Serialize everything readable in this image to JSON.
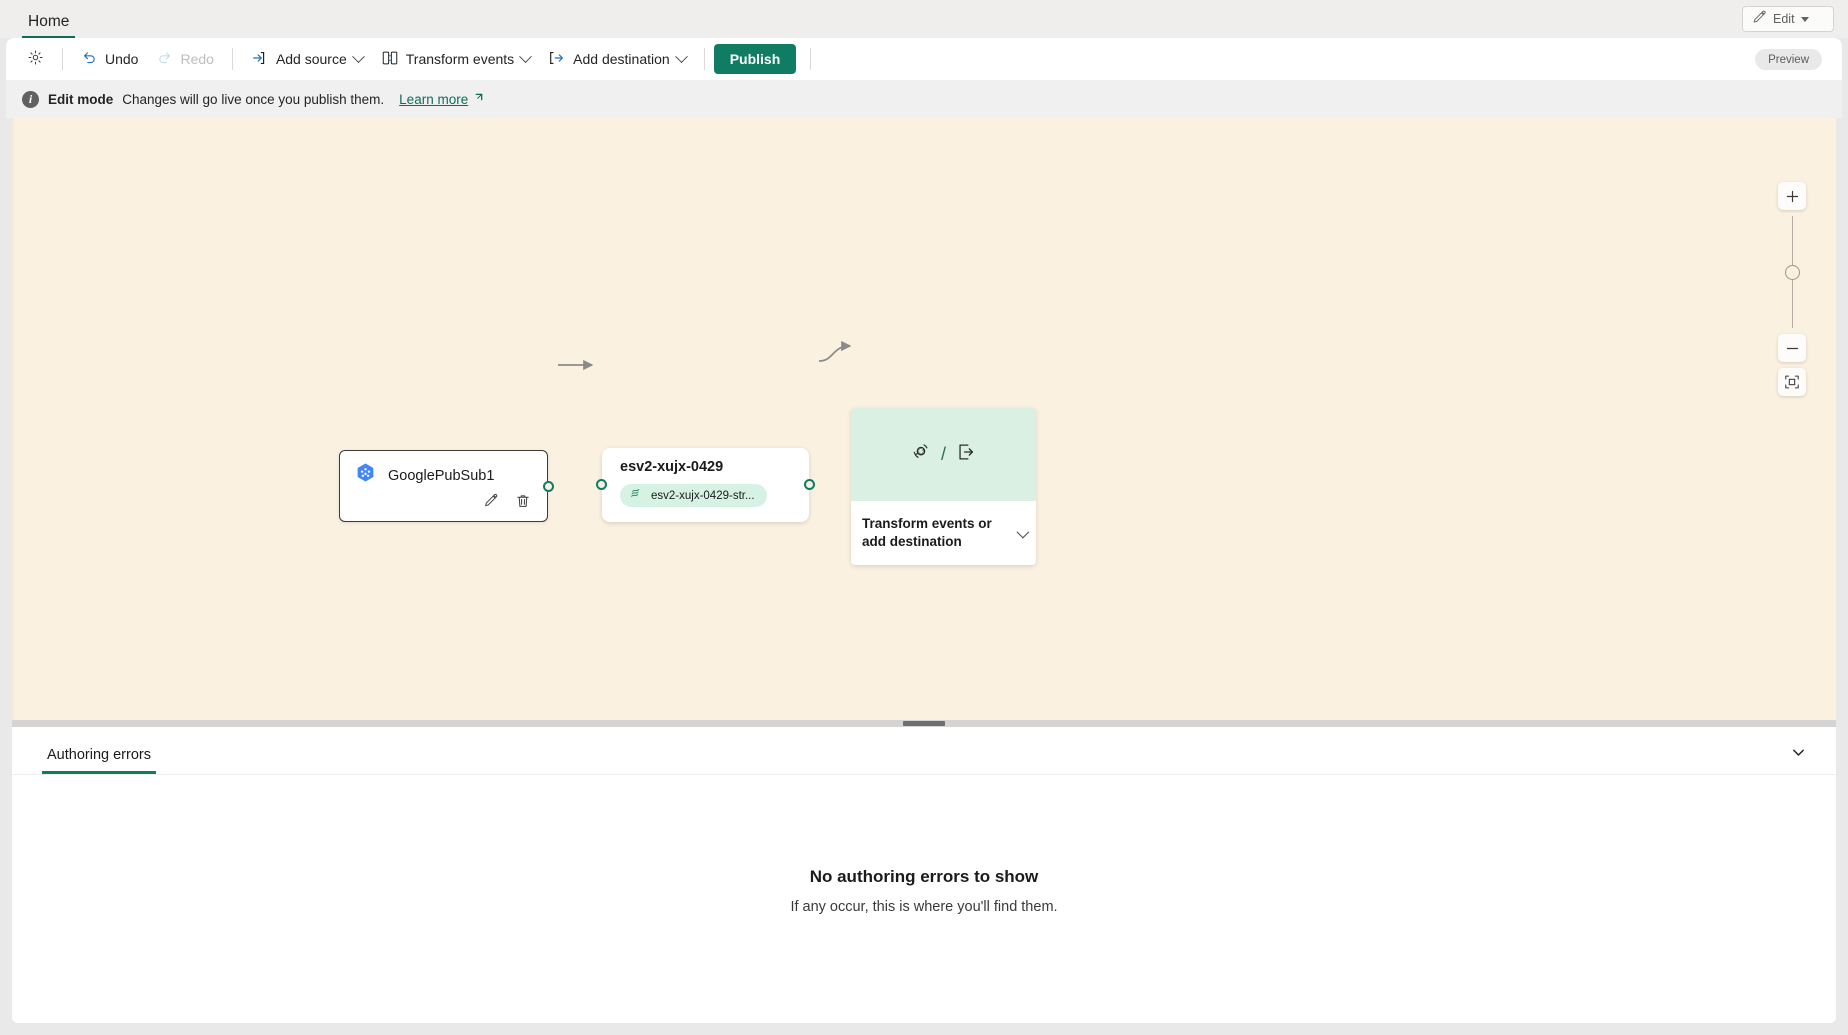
{
  "tabstrip": {
    "tab_label": "Home",
    "edit_button": {
      "label": "Edit",
      "icon": "pencil-icon"
    }
  },
  "commandbar": {
    "settings_icon": "gear-icon",
    "undo": "Undo",
    "redo": "Redo",
    "add_source": "Add source",
    "transform_events": "Transform events",
    "add_destination": "Add destination",
    "publish": "Publish",
    "publish_color": "#107c63",
    "preview_badge": "Preview"
  },
  "banner": {
    "icon": "info-icon",
    "title": "Edit mode",
    "message": "Changes will go live once you publish them.",
    "link": "Learn more",
    "link_icon": "external-link-icon"
  },
  "canvas": {
    "background": "#faf1e0",
    "nodes": {
      "source": {
        "name": "GooglePubSub1",
        "icon": "google-pubsub-icon",
        "icon_color": "#4285f4",
        "edit_icon": "pencil-icon",
        "delete_icon": "trash-icon"
      },
      "stream": {
        "name": "esv2-xujx-0429",
        "pill_label": "esv2-xujx-0429-str...",
        "pill_icon": "stream-icon",
        "pill_color": "#d6f2e4"
      },
      "placeholder": {
        "label": "Transform events or add destination",
        "icon_transform": "transform-icon",
        "icon_separator": "/",
        "icon_destination": "export-icon",
        "chevron": "chevron-down-icon",
        "header_color": "#d9f0e3"
      }
    },
    "zoom_controls": {
      "zoom_in": "+",
      "zoom_out": "−",
      "fit_to_view": "fit-to-view-icon"
    }
  },
  "bottom_panel": {
    "tab_label": "Authoring errors",
    "collapse_icon": "chevron-down-icon",
    "empty_title": "No authoring errors to show",
    "empty_subtitle": "If any occur, this is where you'll find them."
  }
}
